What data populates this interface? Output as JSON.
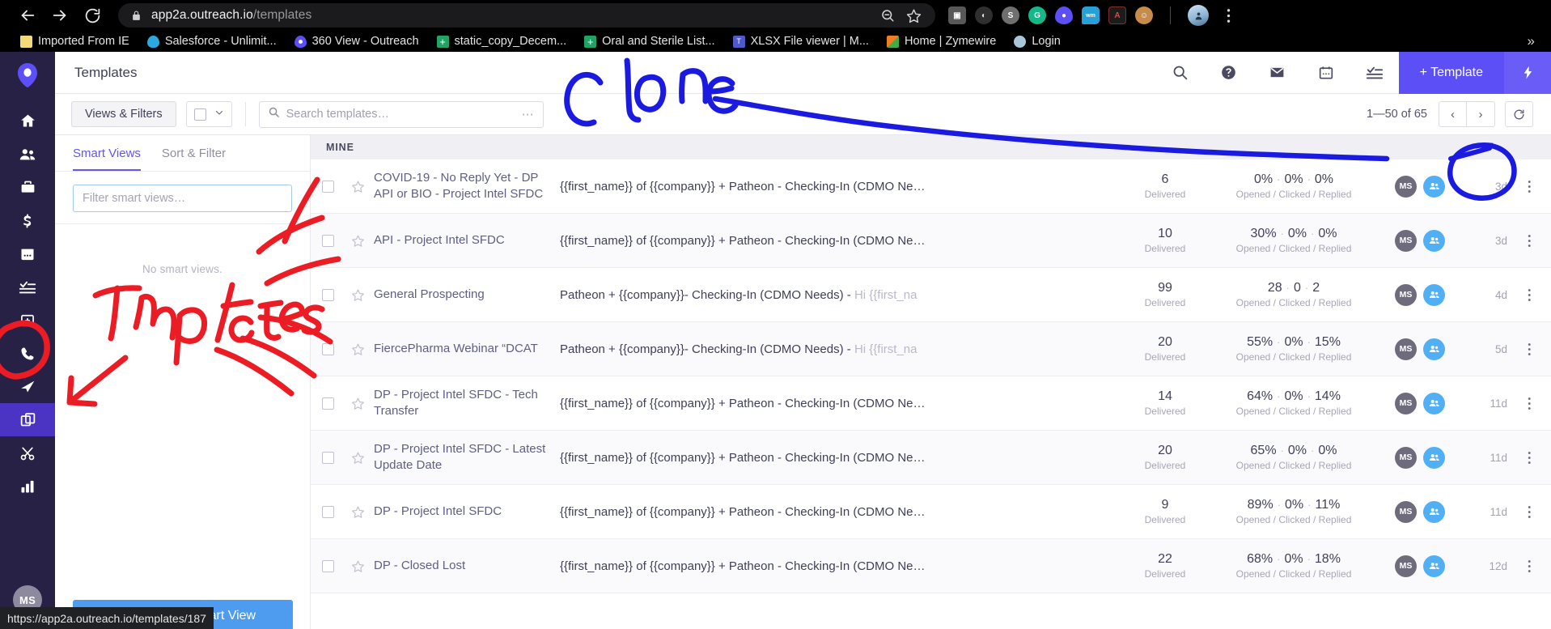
{
  "browser": {
    "url_domain": "app2a.outreach.io",
    "url_path": "/templates",
    "back_icon": "back-arrow-icon",
    "forward_icon": "forward-arrow-icon",
    "reload_icon": "reload-icon",
    "lock_icon": "lock-icon",
    "zoom_out_icon": "zoom-out-icon",
    "bookmark_star_icon": "star-outline-icon",
    "extensions": [
      {
        "name": "screen-capture-extension-icon",
        "glyph": "⧉",
        "bg": "#585858",
        "fg": "#ffffff"
      },
      {
        "name": "moon-extension-icon",
        "glyph": "◐",
        "bg": "#2f2f2f",
        "fg": "#dedede"
      },
      {
        "name": "skype-extension-icon",
        "glyph": "S",
        "bg": "#6b6b6b",
        "fg": "#ffffff"
      },
      {
        "name": "grammarly-extension-icon",
        "glyph": "G",
        "bg": "#14b889",
        "fg": "#ffffff"
      },
      {
        "name": "outreach-extension-icon",
        "glyph": "●",
        "bg": "#5b4ff5",
        "fg": "#ffffff"
      },
      {
        "name": "walkme-extension-icon",
        "glyph": "w",
        "bg": "#27a0d8",
        "fg": "#ffffff"
      },
      {
        "name": "adobe-acrobat-extension-icon",
        "glyph": "A",
        "bg": "#1c1c1c",
        "fg": "#e8453c"
      },
      {
        "name": "avatar-extension-icon",
        "glyph": "◕",
        "bg": "#c78b4a",
        "fg": "#ffffff"
      }
    ],
    "menu_icon": "browser-menu-icon",
    "bookmarks": [
      {
        "label": "Imported From IE",
        "icon": "folder-icon",
        "color": "#f4d97b"
      },
      {
        "label": "Salesforce - Unlimit...",
        "icon": "salesforce-cloud-icon",
        "color": "#2ba9e0"
      },
      {
        "label": "360 View - Outreach",
        "icon": "outreach-pin-icon",
        "color": "#5b4ff5"
      },
      {
        "label": "static_copy_Decem...",
        "icon": "sheets-icon",
        "color": "#21a366"
      },
      {
        "label": "Oral and Sterile List...",
        "icon": "sheets-icon",
        "color": "#21a366"
      },
      {
        "label": "XLSX File viewer | M...",
        "icon": "teams-icon",
        "color": "#5059c9"
      },
      {
        "label": "Home | Zymewire",
        "icon": "zymewire-icon",
        "color": "#f07d22"
      },
      {
        "label": "Login",
        "icon": "login-globe-icon",
        "color": "#4a90c2"
      }
    ],
    "bookmarks_overflow": "»",
    "status_url": "https://app2a.outreach.io/templates/187"
  },
  "sidebar": {
    "logo": "outreach-logo-icon",
    "items": [
      {
        "name": "sidebar-item-home",
        "icon": "home-icon",
        "active": false
      },
      {
        "name": "sidebar-item-prospects",
        "icon": "people-icon",
        "active": false
      },
      {
        "name": "sidebar-item-accounts",
        "icon": "briefcase-icon",
        "active": false
      },
      {
        "name": "sidebar-item-opportunities",
        "icon": "dollar-icon",
        "active": false
      },
      {
        "name": "sidebar-item-calendar",
        "icon": "calendar-icon",
        "active": false
      },
      {
        "name": "sidebar-item-tasks",
        "icon": "tasks-icon",
        "active": false
      },
      {
        "name": "sidebar-item-content",
        "icon": "add-card-icon",
        "active": false
      },
      {
        "name": "sidebar-item-calls",
        "icon": "phone-icon",
        "active": false
      },
      {
        "name": "sidebar-item-sequences",
        "icon": "paper-plane-icon",
        "active": false
      },
      {
        "name": "sidebar-item-templates",
        "icon": "templates-copy-icon",
        "active": true
      },
      {
        "name": "sidebar-item-snippets",
        "icon": "scissors-icon",
        "active": false
      },
      {
        "name": "sidebar-item-reports",
        "icon": "bar-chart-icon",
        "active": false
      }
    ],
    "avatar_initials": "MS"
  },
  "header": {
    "title": "Templates",
    "actions": [
      {
        "name": "search-icon",
        "label": "search"
      },
      {
        "name": "help-icon",
        "label": "help"
      },
      {
        "name": "mail-icon",
        "label": "mail"
      },
      {
        "name": "calendar-icon",
        "label": "calendar"
      },
      {
        "name": "tasks-list-icon",
        "label": "tasks"
      }
    ],
    "new_template_label": "+ Template",
    "bolt_icon": "lightning-bolt-icon"
  },
  "toolbar": {
    "views_filters_label": "Views & Filters",
    "select_chevron_icon": "chevron-down-icon",
    "search_placeholder": "Search templates…",
    "search_value": "",
    "search_icon": "search-icon",
    "overflow_dots": "⋯",
    "pager_count": "1—50 of 65",
    "prev_label": "‹",
    "next_label": "›",
    "refresh_icon": "refresh-icon"
  },
  "smart_views": {
    "tabs": [
      {
        "label": "Smart Views",
        "active": true
      },
      {
        "label": "Sort & Filter",
        "active": false
      }
    ],
    "filter_placeholder": "Filter smart views…",
    "filter_value": "",
    "empty_text": "No smart views.",
    "save_button_label": "Save as New Smart View"
  },
  "table": {
    "group_label": "MINE",
    "stats_caption": "Opened / Clicked / Replied",
    "delivered_caption": "Delivered",
    "avatar_initials": "MS",
    "team_icon": "team-group-icon",
    "star_icon": "star-outline-icon",
    "kebab_icon": "kebab-menu-icon",
    "rows": [
      {
        "name": "COVID-19 - No Reply Yet - DP API or BIO - Project Intel SFDC",
        "subject": "{{first_name}} of {{company}} + Patheon - Checking-In (CDMO Ne…",
        "preview": "",
        "delivered": "6",
        "opened": "0%",
        "clicked": "0%",
        "replied": "0%",
        "age": "3d"
      },
      {
        "name": "API - Project Intel SFDC",
        "subject": "{{first_name}} of {{company}} + Patheon - Checking-In (CDMO Ne…",
        "preview": "",
        "delivered": "10",
        "opened": "30%",
        "clicked": "0%",
        "replied": "0%",
        "age": "3d"
      },
      {
        "name": "General Prospecting",
        "subject": "Patheon + {{company}}- Checking-In (CDMO Needs) - ",
        "preview": "Hi {{first_na",
        "delivered": "99",
        "opened": "28",
        "clicked": "0",
        "replied": "2",
        "age": "4d"
      },
      {
        "name": "FiercePharma Webinar “DCAT",
        "subject": "Patheon + {{company}}- Checking-In (CDMO Needs) - ",
        "preview": "Hi {{first_na",
        "delivered": "20",
        "opened": "55%",
        "clicked": "0%",
        "replied": "15%",
        "age": "5d"
      },
      {
        "name": "DP - Project Intel SFDC - Tech Transfer",
        "subject": "{{first_name}} of {{company}} + Patheon - Checking-In (CDMO Ne…",
        "preview": "",
        "delivered": "14",
        "opened": "64%",
        "clicked": "0%",
        "replied": "14%",
        "age": "11d"
      },
      {
        "name": "DP - Project Intel SFDC - Latest Update Date",
        "subject": "{{first_name}} of {{company}} + Patheon - Checking-In (CDMO Ne…",
        "preview": "",
        "delivered": "20",
        "opened": "65%",
        "clicked": "0%",
        "replied": "0%",
        "age": "11d"
      },
      {
        "name": "DP - Project Intel SFDC",
        "subject": "{{first_name}} of {{company}} + Patheon - Checking-In (CDMO Ne…",
        "preview": "",
        "delivered": "9",
        "opened": "89%",
        "clicked": "0%",
        "replied": "11%",
        "age": "11d"
      },
      {
        "name": "DP - Closed Lost",
        "subject": "{{first_name}} of {{company}} + Patheon - Checking-In (CDMO Ne…",
        "preview": "",
        "delivered": "22",
        "opened": "68%",
        "clicked": "0%",
        "replied": "18%",
        "age": "12d"
      }
    ]
  },
  "annotations": {
    "clone_text": "Clone",
    "clone_color": "#1a1ae0",
    "templates_text": "Templates",
    "templates_color": "#ec1c24"
  },
  "colors": {
    "brand_purple": "#5b4ff5",
    "rail_navy": "#262145",
    "rail_active": "#4b34c4",
    "accent_blue": "#4d9cf0",
    "text_dark": "#3f3f57",
    "text_muted": "#a7a7b8"
  }
}
